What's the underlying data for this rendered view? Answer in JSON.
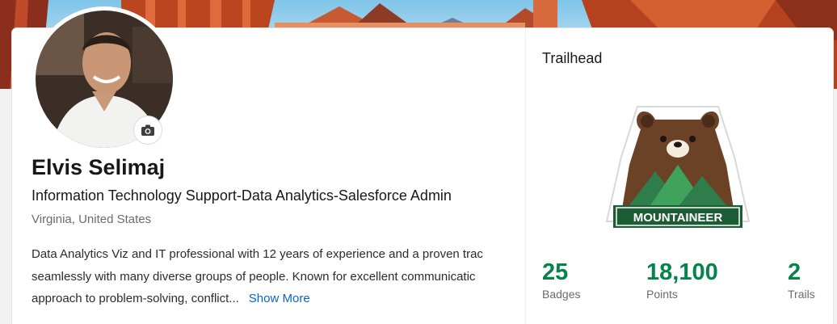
{
  "profile": {
    "name": "Elvis Selimaj",
    "headline": "Information Technology Support-Data Analytics-Salesforce Admin",
    "location": "Virginia, United States",
    "about_lines": [
      "Data Analytics Viz and IT professional with 12 years of experience and a proven trac",
      "seamlessly with many diverse groups of people. Known for excellent communicatic",
      "approach to problem-solving, conflict..."
    ],
    "show_more_label": "Show More"
  },
  "trailhead": {
    "title": "Trailhead",
    "rank_badge": "MOUNTAINEER",
    "stats": [
      {
        "value": "25",
        "label": "Badges"
      },
      {
        "value": "18,100",
        "label": "Points"
      },
      {
        "value": "2",
        "label": "Trails"
      }
    ]
  },
  "colors": {
    "accent_green": "#04844b",
    "link_blue": "#0a66c2",
    "bear_brown": "#6b4226"
  },
  "icons": [
    "camera-icon",
    "mountaineer-bear-badge"
  ]
}
